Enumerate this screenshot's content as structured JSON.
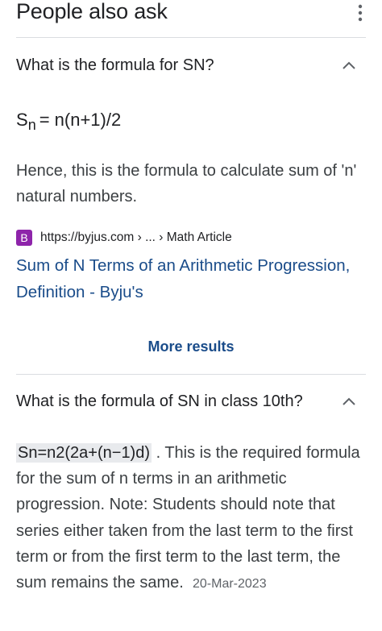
{
  "header": {
    "title": "People also ask"
  },
  "questions": [
    {
      "question": "What is the formula for SN?",
      "expanded": true,
      "formula_main": "S",
      "formula_sub": "n",
      "formula_rest": "= n(n+1)/2",
      "answer": "Hence, this is the formula to calculate sum of 'n' natural numbers.",
      "source": {
        "favicon_letter": "B",
        "url": "https://byjus.com › ... › Math Article"
      },
      "result_title": "Sum of N Terms of an Arithmetic Progression, Definition - Byju's"
    },
    {
      "question": "What is the formula of SN in class 10th?",
      "expanded": true,
      "answer_highlight": "Sn=n2(2a+(n−1)d)",
      "answer_rest": " . This is the required formula for the sum of n terms in an arithmetic progression. Note: Students should note that series either taken from the last term to the first term or from the first term to the last term, the sum remains the same.",
      "date": "20-Mar-2023"
    }
  ],
  "more_results_label": "More results",
  "colors": {
    "link": "#1a4c8a",
    "divider": "#dadce0",
    "favicon": "#8e24aa"
  }
}
